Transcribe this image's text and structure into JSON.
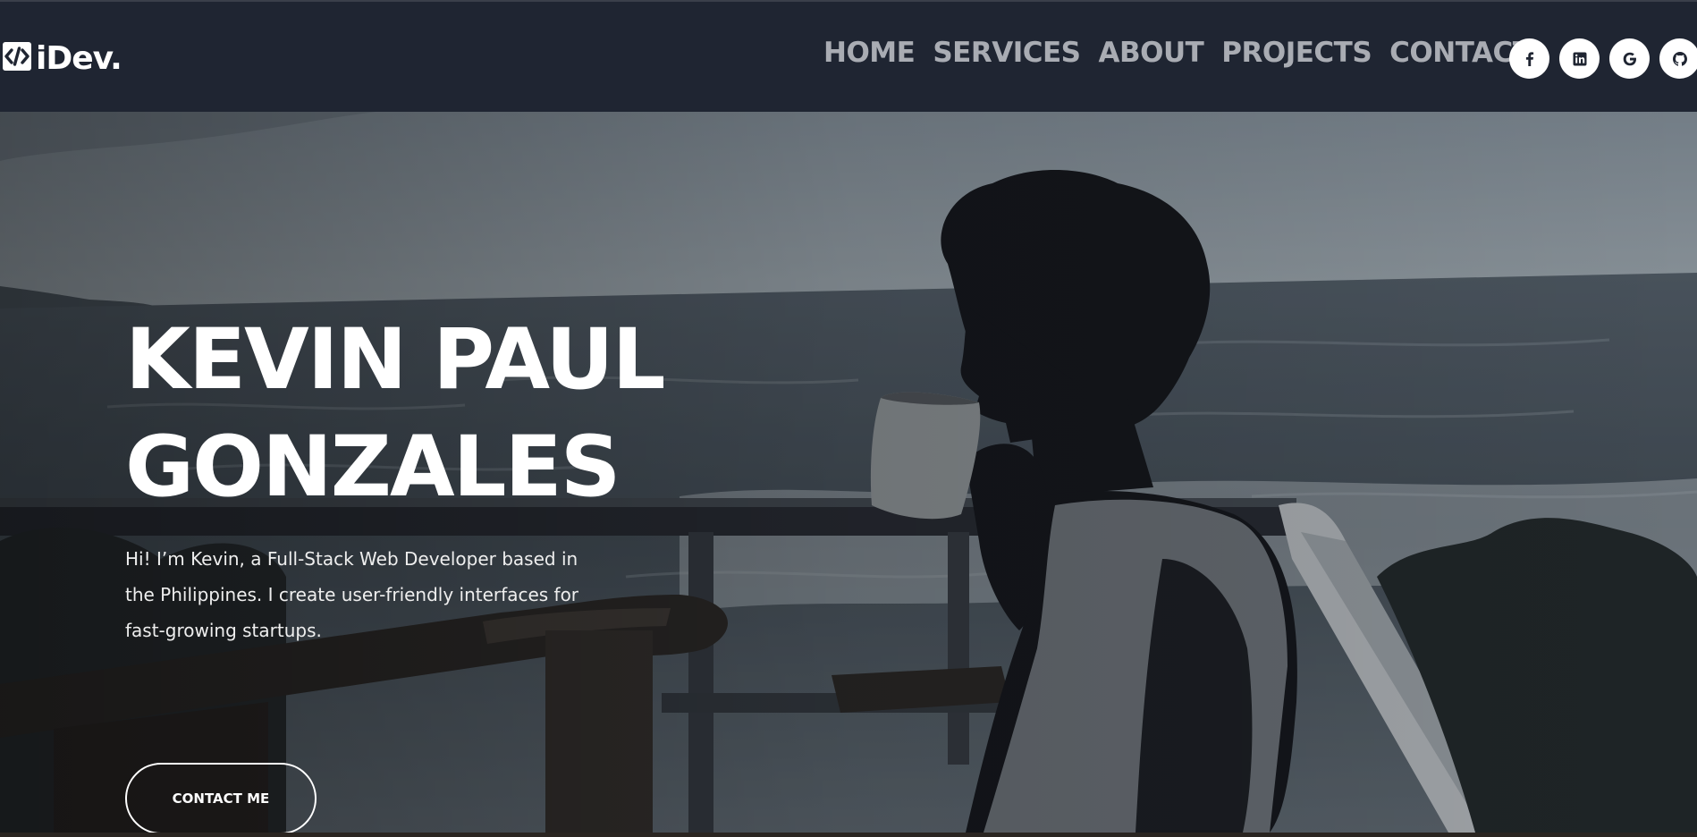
{
  "header": {
    "logo_text": "iDev.",
    "logo_icon": "code-icon",
    "nav": [
      {
        "label": "HOME"
      },
      {
        "label": "SERVICES"
      },
      {
        "label": "ABOUT"
      },
      {
        "label": "PROJECTS"
      },
      {
        "label": "CONTACT"
      }
    ],
    "social": [
      {
        "icon": "facebook-icon"
      },
      {
        "icon": "linkedin-icon"
      },
      {
        "icon": "google-icon"
      },
      {
        "icon": "github-icon"
      }
    ]
  },
  "hero": {
    "name_line1": "KEVIN PAUL",
    "name_line2": "GONZALES",
    "bio": "Hi! I’m Kevin, a Full-Stack Web Developer based in the Philippines. I create user-friendly interfaces for fast-growing startups.",
    "cta_label": "CONTACT ME",
    "background": "photo-man-drinking-coffee-on-seaside-balcony"
  },
  "colors": {
    "header_bg": "#1f2532",
    "nav_text": "#a9acb3",
    "hero_text": "#ffffff"
  }
}
